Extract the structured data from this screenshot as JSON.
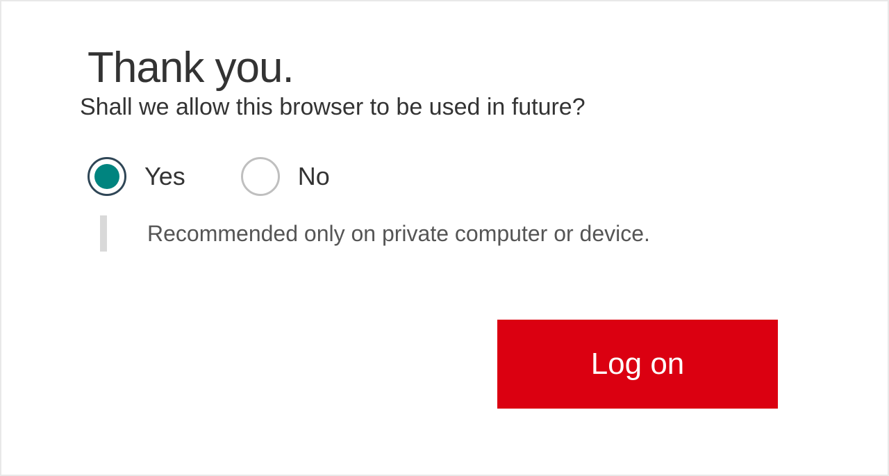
{
  "heading": "Thank you.",
  "subheading": "Shall we allow this browser to be used in future?",
  "options": {
    "yes": "Yes",
    "no": "No"
  },
  "hint": "Recommended only on private computer or device.",
  "button": {
    "logon": "Log on"
  },
  "colors": {
    "accent_teal": "#00847f",
    "brand_red": "#db0011"
  }
}
